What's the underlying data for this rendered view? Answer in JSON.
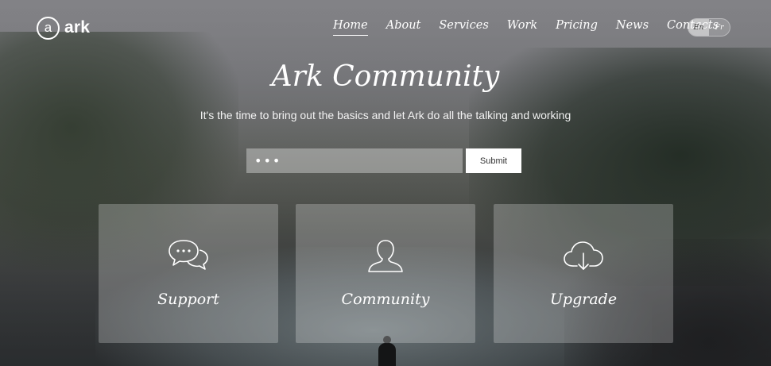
{
  "brand": {
    "badge": "a",
    "name": "ark"
  },
  "nav": {
    "items": [
      {
        "label": "Home",
        "active": true
      },
      {
        "label": "About",
        "active": false
      },
      {
        "label": "Services",
        "active": false
      },
      {
        "label": "Work",
        "active": false
      },
      {
        "label": "Pricing",
        "active": false
      },
      {
        "label": "News",
        "active": false
      },
      {
        "label": "Contacts",
        "active": false
      }
    ]
  },
  "language": {
    "options": [
      "En",
      "Fr"
    ],
    "selected": "En"
  },
  "hero": {
    "title": "Ark Community",
    "subtitle": "It's the time to bring out the basics and let Ark do all the talking and working"
  },
  "form": {
    "input_value": "•••",
    "submit_label": "Submit"
  },
  "cards": [
    {
      "label": "Support",
      "icon": "chat-bubbles-icon"
    },
    {
      "label": "Community",
      "icon": "user-icon"
    },
    {
      "label": "Upgrade",
      "icon": "cloud-download-icon"
    }
  ],
  "colors": {
    "text": "#ffffff",
    "card_overlay": "rgba(255,255,255,0.24)",
    "button_bg": "#ffffff",
    "button_text": "#333333"
  }
}
